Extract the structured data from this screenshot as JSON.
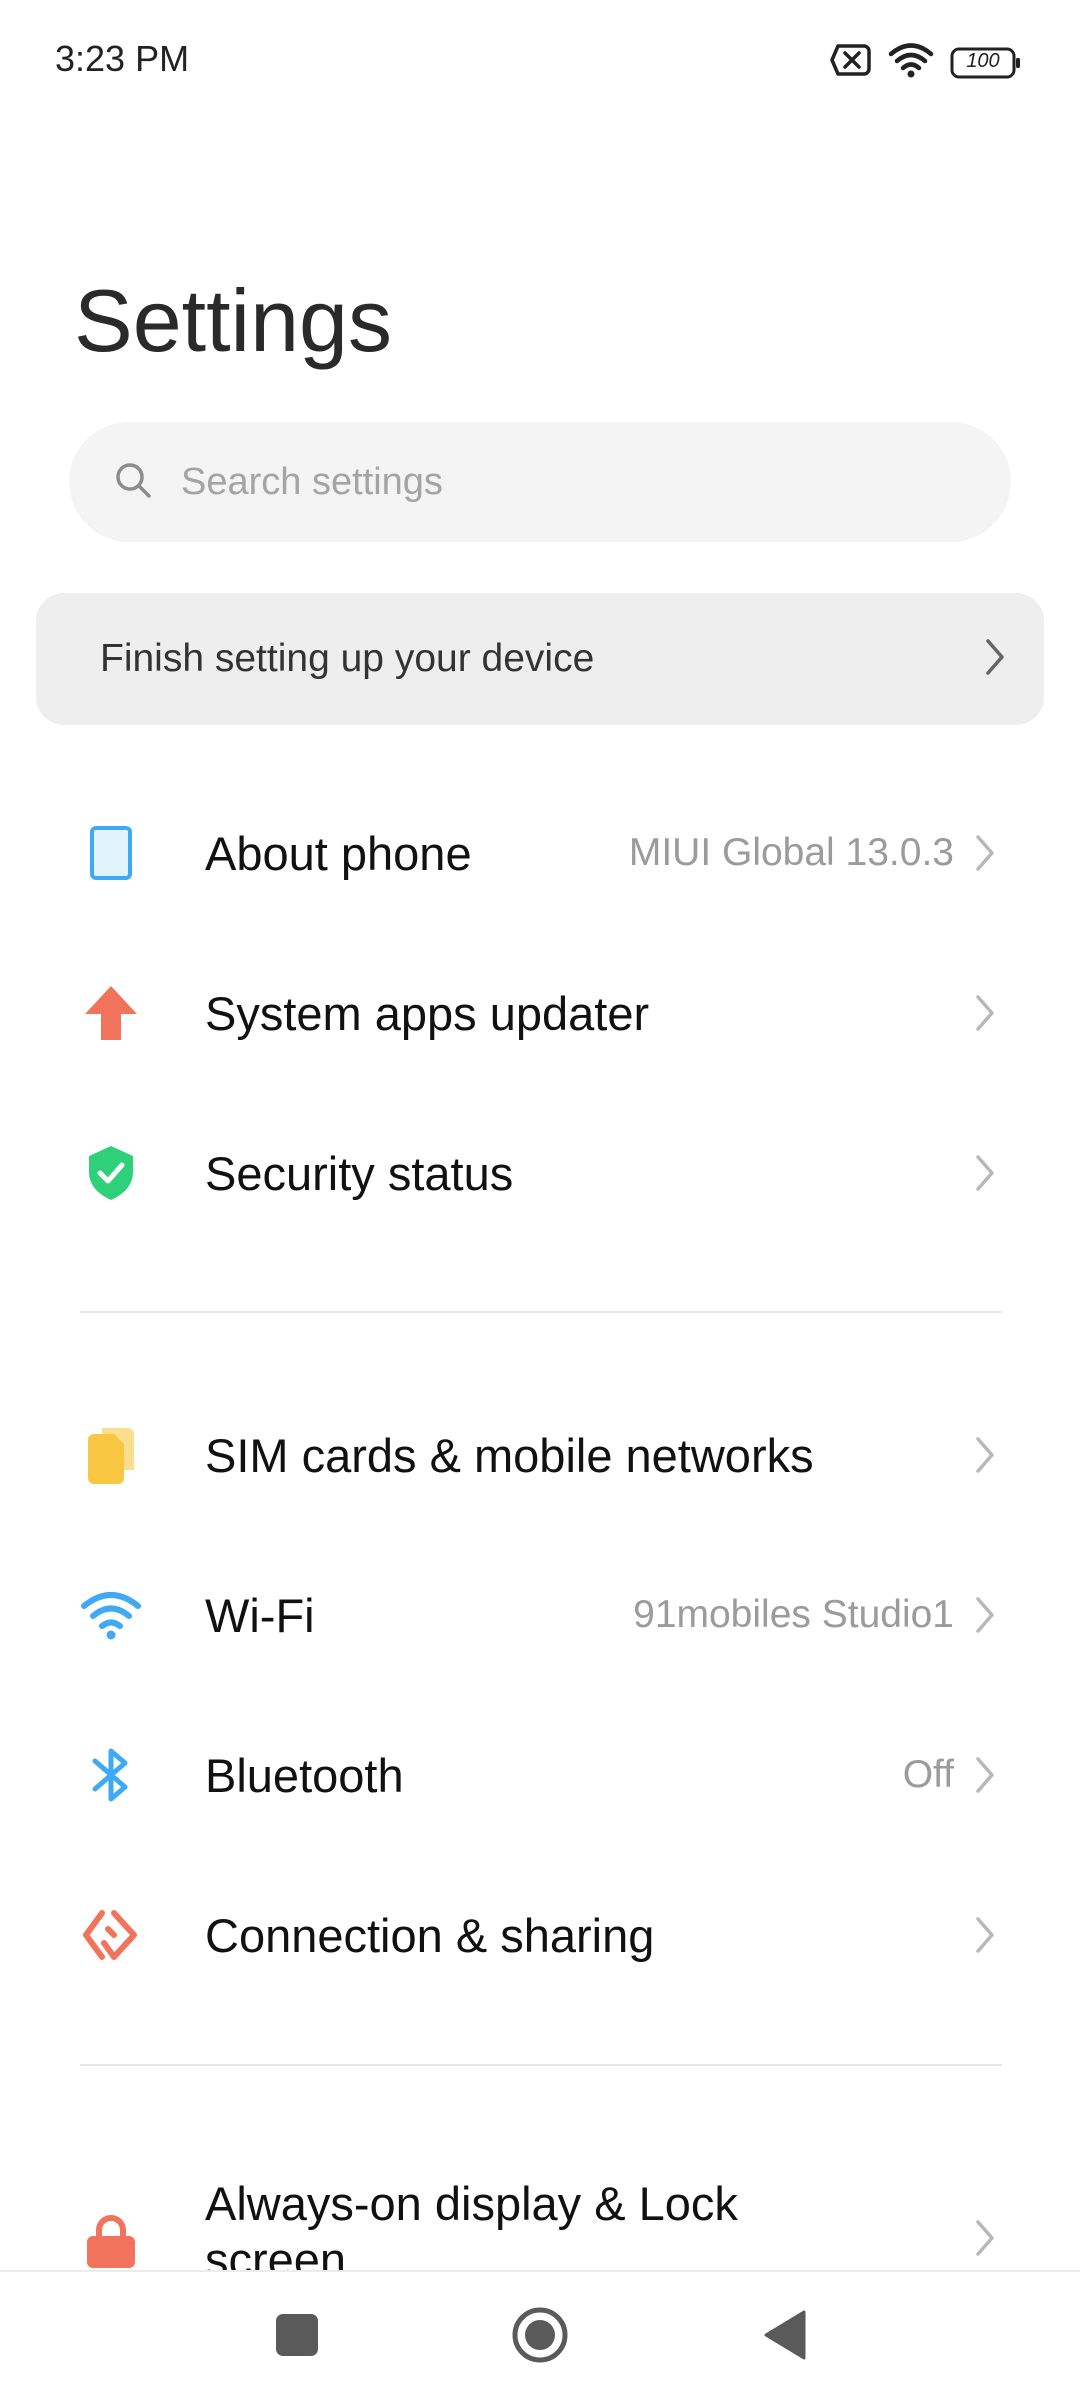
{
  "status_bar": {
    "time": "3:23 PM",
    "battery": "100",
    "icons": [
      "no-sim-icon",
      "wifi-signal-icon",
      "battery-icon"
    ]
  },
  "page": {
    "title": "Settings"
  },
  "search": {
    "placeholder": "Search settings",
    "value": ""
  },
  "setup_card": {
    "label": "Finish setting up your device"
  },
  "sections": [
    {
      "items": [
        {
          "label": "About phone",
          "value": "MIUI Global 13.0.3",
          "icon": "phone-icon",
          "color": "#3fa9f5"
        },
        {
          "label": "System apps updater",
          "value": "",
          "icon": "arrow-up-icon",
          "color": "#f2735c"
        },
        {
          "label": "Security status",
          "value": "",
          "icon": "shield-check-icon",
          "color": "#2fd07a"
        }
      ]
    },
    {
      "items": [
        {
          "label": "SIM cards & mobile networks",
          "value": "",
          "icon": "sim-card-icon",
          "color": "#f9c642"
        },
        {
          "label": "Wi-Fi",
          "value": "91mobiles Studio1",
          "icon": "wifi-icon",
          "color": "#3fa9f5"
        },
        {
          "label": "Bluetooth",
          "value": "Off",
          "icon": "bluetooth-icon",
          "color": "#3fa9f5"
        },
        {
          "label": "Connection & sharing",
          "value": "",
          "icon": "connection-sharing-icon",
          "color": "#f2735c"
        }
      ]
    },
    {
      "items": [
        {
          "label": "Always-on display & Lock screen",
          "value": "",
          "icon": "lock-icon",
          "color": "#f2735c"
        }
      ]
    }
  ],
  "nav_bar": {
    "buttons": [
      "recents-button",
      "home-button",
      "back-button"
    ]
  }
}
